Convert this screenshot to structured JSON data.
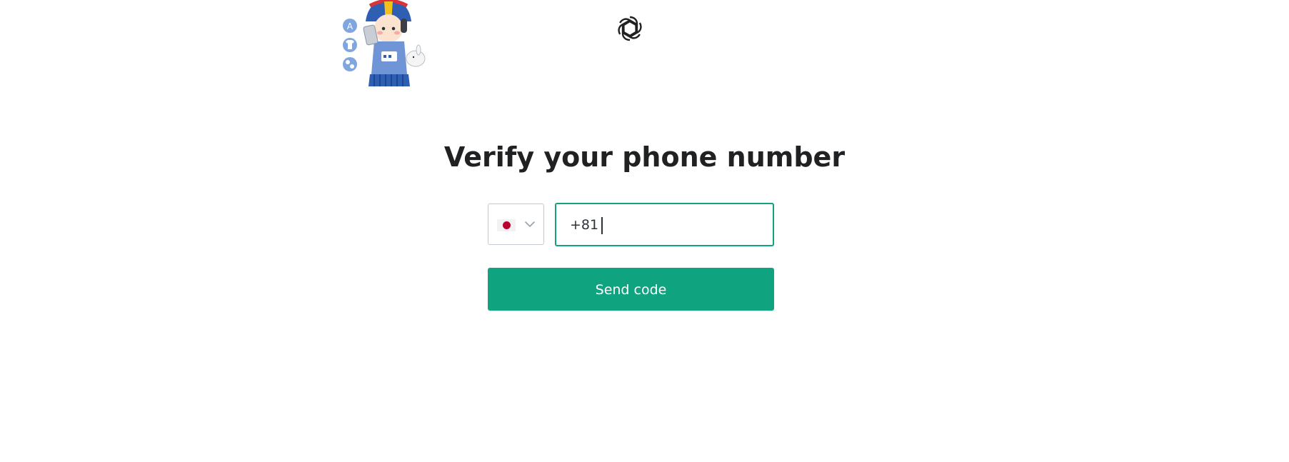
{
  "header": {
    "logo_icon": "openai-logo-icon",
    "sticker_icon": "mascot-sticker-icon"
  },
  "main": {
    "title": "Verify your phone number",
    "country_select": {
      "flag_icon": "japan-flag-icon",
      "chevron_icon": "chevron-down-icon"
    },
    "phone_input": {
      "value": "+81"
    },
    "send_button_label": "Send code"
  },
  "colors": {
    "accent": "#10a37f",
    "title": "#202123",
    "text": "#2d333a",
    "border": "#c2c8d0",
    "flag_red": "#bc002d"
  }
}
